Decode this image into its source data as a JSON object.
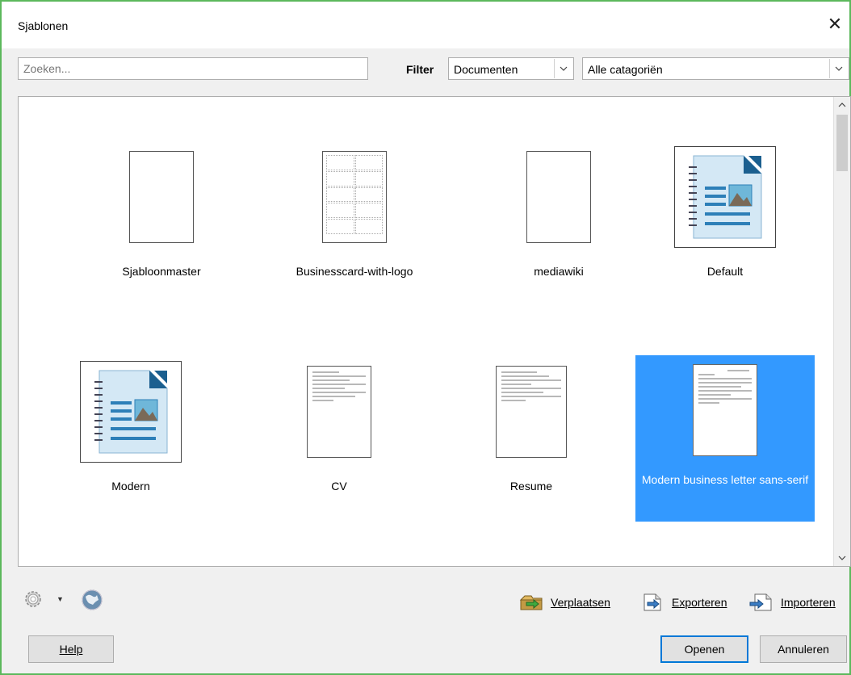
{
  "window": {
    "title": "Sjablonen"
  },
  "search": {
    "placeholder": "Zoeken..."
  },
  "filter": {
    "label": "Filter",
    "type_value": "Documenten",
    "category_value": "Alle catagoriën"
  },
  "templates": [
    {
      "name": "Sjabloonmaster",
      "thumb": "blank"
    },
    {
      "name": "Businesscard-with-logo",
      "thumb": "cards"
    },
    {
      "name": "mediawiki",
      "thumb": "blank"
    },
    {
      "name": "Default",
      "thumb": "libreoffice-writer"
    },
    {
      "name": "Modern",
      "thumb": "libreoffice-writer"
    },
    {
      "name": "CV",
      "thumb": "document"
    },
    {
      "name": "Resume",
      "thumb": "document"
    },
    {
      "name": "Modern business letter sans-serif",
      "thumb": "document",
      "selected": true
    }
  ],
  "actions": {
    "move_label": "Verplaatsen",
    "export_label": "Exporteren",
    "import_label": "Importeren"
  },
  "buttons": {
    "help": "Help",
    "open": "Openen",
    "cancel": "Annuleren"
  },
  "colors": {
    "selection": "#3399ff",
    "window_border": "#5cb85c"
  }
}
